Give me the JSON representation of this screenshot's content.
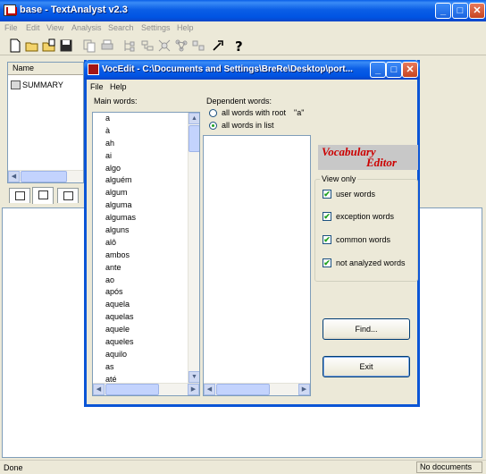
{
  "app": {
    "title": "base - TextAnalyst v2.3",
    "menu": [
      "File",
      "Edit",
      "View",
      "Analysis",
      "Search",
      "Settings",
      "Help"
    ],
    "left_pane": {
      "column_header": "Name",
      "tree_item": "SUMMARY"
    },
    "status": {
      "left": "Done",
      "right": "No documents"
    }
  },
  "dialog": {
    "title": "VocEdit - C:\\Documents and Settings\\BreRe\\Desktop\\port...",
    "menu": [
      "File",
      "Help"
    ],
    "main_words_label": "Main words:",
    "main_words": [
      "a",
      "à",
      "ah",
      "ai",
      "algo",
      "alguém",
      "algum",
      "alguma",
      "algumas",
      "alguns",
      "alô",
      "ambos",
      "ante",
      "ao",
      "após",
      "aquela",
      "aquelas",
      "aquele",
      "aqueles",
      "aquilo",
      "as",
      "até"
    ],
    "dependent_words_label": "Dependent words:",
    "radio_root_label": "all words with root",
    "radio_root_value": "\"a\"",
    "radio_list_label": "all words in list",
    "logo_line1": "Vocabulary",
    "logo_line2": "Editor",
    "view_only_label": "View only",
    "checkboxes": [
      {
        "label": "user words",
        "checked": true
      },
      {
        "label": "exception words",
        "checked": true
      },
      {
        "label": "common words",
        "checked": true
      },
      {
        "label": "not analyzed words",
        "checked": true
      }
    ],
    "find_button": "Find...",
    "exit_button": "Exit",
    "checkmark": "✔"
  }
}
